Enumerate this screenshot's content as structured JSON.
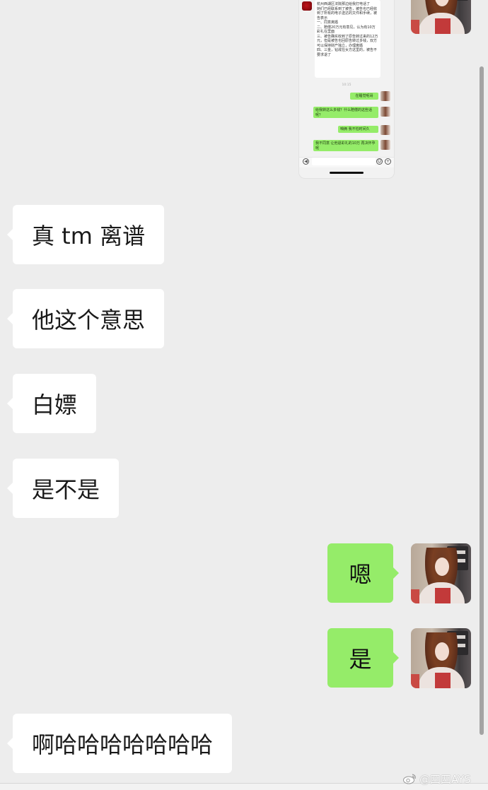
{
  "embedded_screenshot": {
    "incoming_message": "杭州西湖区法院那边给我打电话了\n她们已经联系到了被告，被告也已经收到了所有的电子送达的文件和手续，被告表示\n一、同意离婚\n二、赔偿20万元有意见，认为有10万彩礼在里面\n三、被告确实收到了原告转过来的12万元，但是被告也回原告转过多钱，双方可以保持财产独立，办理离婚\n四、三金，钻戒在女方这里的，被告不要求退了",
    "timestamp": "10:15",
    "outgoing_messages": [
      "在睡觉呢哥",
      "给我转这么多钱？什么赔偿的这些话呢？",
      "咱俩 我不怕时间久",
      "我不同意 让他退彩礼的10万 再决怀孕呢"
    ],
    "input_bar": {
      "voice_icon": "◀",
      "emoji_icon": "☺",
      "plus_icon": "+"
    }
  },
  "messages": [
    {
      "side": "left",
      "text": "真 tm 离谱"
    },
    {
      "side": "left",
      "text": "他这个意思"
    },
    {
      "side": "left",
      "text": "白嫖"
    },
    {
      "side": "left",
      "text": "是不是"
    },
    {
      "side": "right",
      "text": "嗯"
    },
    {
      "side": "right",
      "text": "是"
    },
    {
      "side": "left",
      "text": "啊哈哈哈哈哈哈哈"
    }
  ],
  "watermark": {
    "icon": "weibo-icon",
    "text": "@四四AYS"
  },
  "colors": {
    "background": "#ededed",
    "incoming_bubble": "#ffffff",
    "outgoing_bubble": "#95ec69",
    "scrollbar": "#a3a3a3"
  }
}
